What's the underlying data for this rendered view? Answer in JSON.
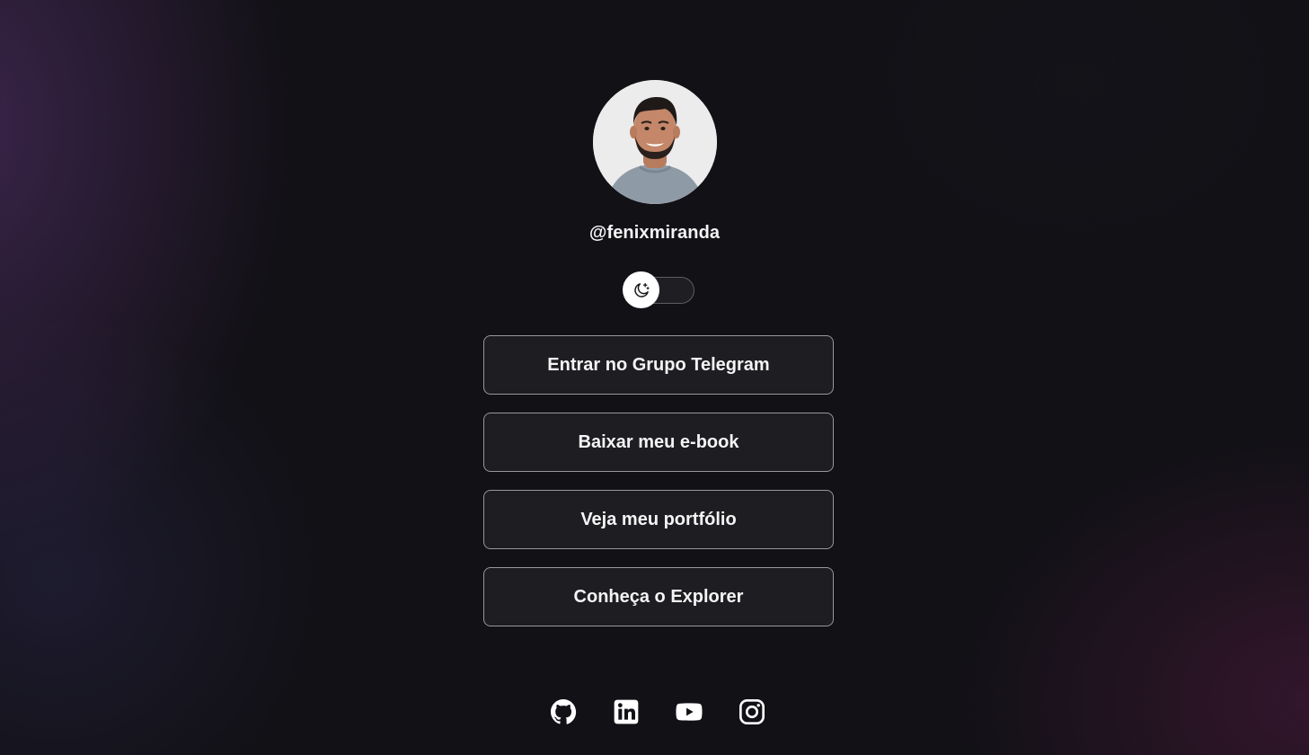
{
  "profile": {
    "username": "@fenixmiranda",
    "avatar_icon": "profile-photo"
  },
  "theme_switch": {
    "icon": "moon-stars-icon",
    "state": "dark"
  },
  "links": [
    {
      "label": "Entrar no Grupo Telegram",
      "id": "telegram"
    },
    {
      "label": "Baixar meu e-book",
      "id": "ebook"
    },
    {
      "label": "Veja meu portfólio",
      "id": "portfolio"
    },
    {
      "label": "Conheça o Explorer",
      "id": "explorer"
    }
  ],
  "social": [
    {
      "name": "github",
      "icon": "github-icon"
    },
    {
      "name": "linkedin",
      "icon": "linkedin-icon"
    },
    {
      "name": "youtube",
      "icon": "youtube-icon"
    },
    {
      "name": "instagram",
      "icon": "instagram-icon"
    }
  ],
  "colors": {
    "background": "#121116",
    "text": "#f4f4f5",
    "button_border": "#8c8b90",
    "accent_glow": "#5c3476"
  }
}
